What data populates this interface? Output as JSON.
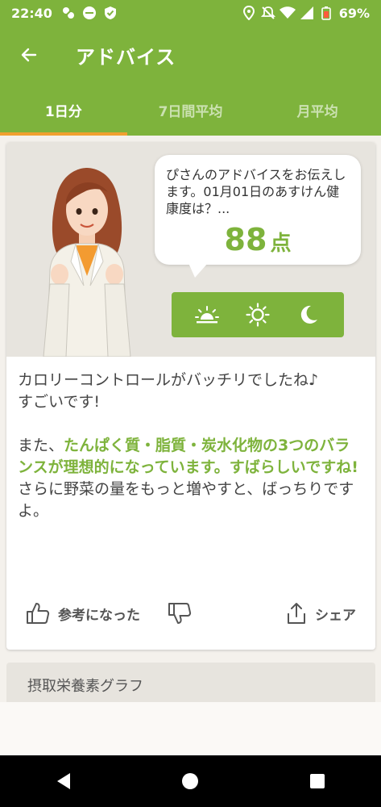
{
  "status_bar": {
    "time": "22:40",
    "battery": "69%",
    "left_icons": [
      "overlap-icon",
      "app-badge-icon",
      "shield-check-icon"
    ],
    "right_icons": [
      "location-icon",
      "mute-icon",
      "wifi-icon",
      "signal-icon",
      "battery-icon"
    ]
  },
  "app_bar": {
    "title": "アドバイス",
    "back_icon": "arrow-left-icon"
  },
  "tabs": [
    {
      "label": "1日分",
      "active": true
    },
    {
      "label": "7日間平均",
      "active": false
    },
    {
      "label": "月平均",
      "active": false
    }
  ],
  "advice_card": {
    "bubble_text": "ぴさんのアドバイスをお伝えします。01月01日のあすけん健康度は？...",
    "score_value": "88",
    "score_unit": "点",
    "meal_buttons": [
      "sunrise-icon",
      "sun-icon",
      "moon-icon"
    ],
    "advice_line1": "カロリーコントロールがバッチリでしたね♪",
    "advice_line2": "すごいです!",
    "advice_line3_prefix": "また、",
    "advice_line3_highlight": "たんぱく質・脂質・炭水化物の3つのバランスが理想的になっています。すばらしいですね!",
    "advice_line4": "さらに野菜の量をもっと増やすと、ばっちりですよ。",
    "helpful_label": "参考になった",
    "share_label": "シェア"
  },
  "graph_section": {
    "title": "摂取栄養素グラフ"
  },
  "colors": {
    "brand_green": "#7eb33c",
    "tab_indicator": "#f0a030",
    "hero_bg": "#e7e4de"
  }
}
